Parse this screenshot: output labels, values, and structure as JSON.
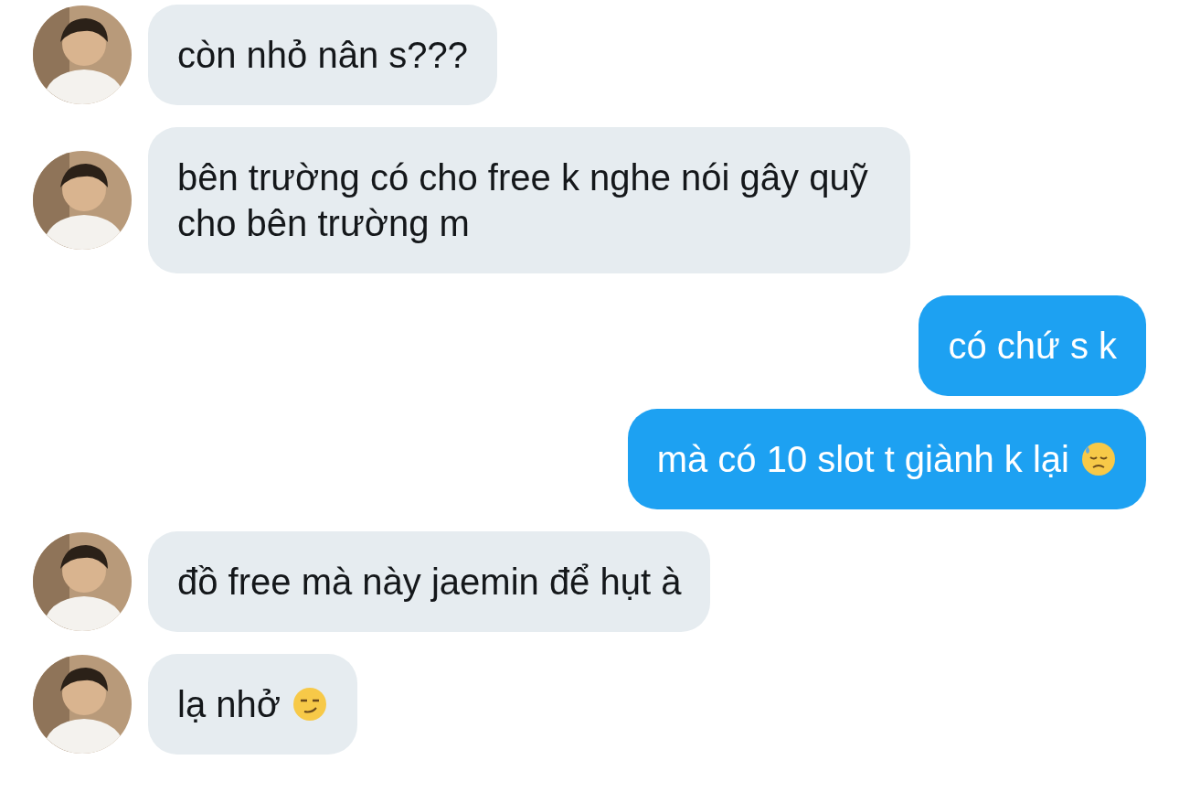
{
  "messages": [
    {
      "kind": "incoming",
      "text": "còn nhỏ nân s???"
    },
    {
      "kind": "incoming",
      "text": "bên trường có cho free k nghe nói gây quỹ cho bên trường m"
    },
    {
      "kind": "outgoing",
      "text": "có chứ s k"
    },
    {
      "kind": "outgoing",
      "text": "mà có 10 slot t giành k lại",
      "emoji": {
        "kind": "sweat"
      }
    },
    {
      "kind": "incoming",
      "text": "đồ free mà này jaemin để hụt à"
    },
    {
      "kind": "incoming",
      "text": "lạ nhở",
      "emoji": {
        "kind": "smirk"
      }
    }
  ]
}
